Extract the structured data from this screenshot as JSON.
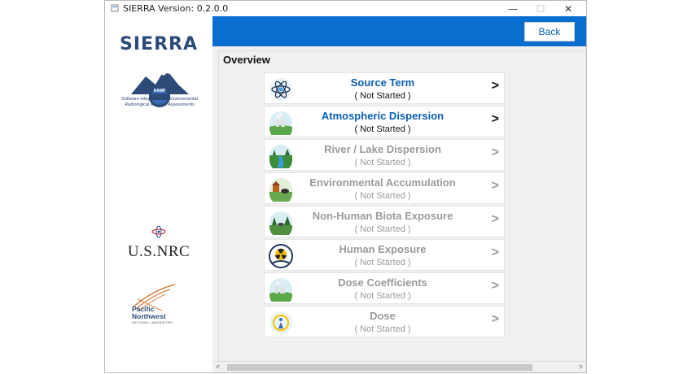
{
  "window": {
    "title": "SIERRA Version: 0.2.0.0",
    "minimize_glyph": "—",
    "maximize_glyph": "☐",
    "close_glyph": "✕"
  },
  "sidebar": {
    "sierra_title": "SIERRA",
    "sierra_badge": "RAMP",
    "sierra_subtitle": "Software Integration for Environmental Radiological Release Assessments",
    "nrc_text": "U.S.NRC",
    "pnnl_name_1": "Pacific",
    "pnnl_name_2": "Northwest",
    "pnnl_sub": "NATIONAL LABORATORY"
  },
  "header": {
    "back_label": "Back",
    "accent_color": "#0a6ed1"
  },
  "main": {
    "section_title": "Overview",
    "items": [
      {
        "title": "Source Term",
        "status": "( Not Started )",
        "arrow": ">",
        "icon": "atom-icon"
      },
      {
        "title": "Atmospheric Dispersion",
        "status": "( Not Started )",
        "arrow": ">",
        "icon": "atmosphere-icon"
      },
      {
        "title": "River / Lake Dispersion",
        "status": "( Not Started )",
        "arrow": ">",
        "icon": "river-icon"
      },
      {
        "title": "Environmental Accumulation",
        "status": "( Not Started )",
        "arrow": ">",
        "icon": "farm-icon"
      },
      {
        "title": "Non-Human Biota Exposure",
        "status": "( Not Started )",
        "arrow": ">",
        "icon": "biota-icon"
      },
      {
        "title": "Human Exposure",
        "status": "( Not Started )",
        "arrow": ">",
        "icon": "radiation-icon"
      },
      {
        "title": "Dose Coefficients",
        "status": "( Not Started )",
        "arrow": ">",
        "icon": "plant-icon"
      },
      {
        "title": "Dose",
        "status": "( Not Started )",
        "arrow": ">",
        "icon": "person-dose-icon"
      }
    ]
  },
  "scrollbar": {
    "left_arrow": "<",
    "right_arrow": ">"
  }
}
